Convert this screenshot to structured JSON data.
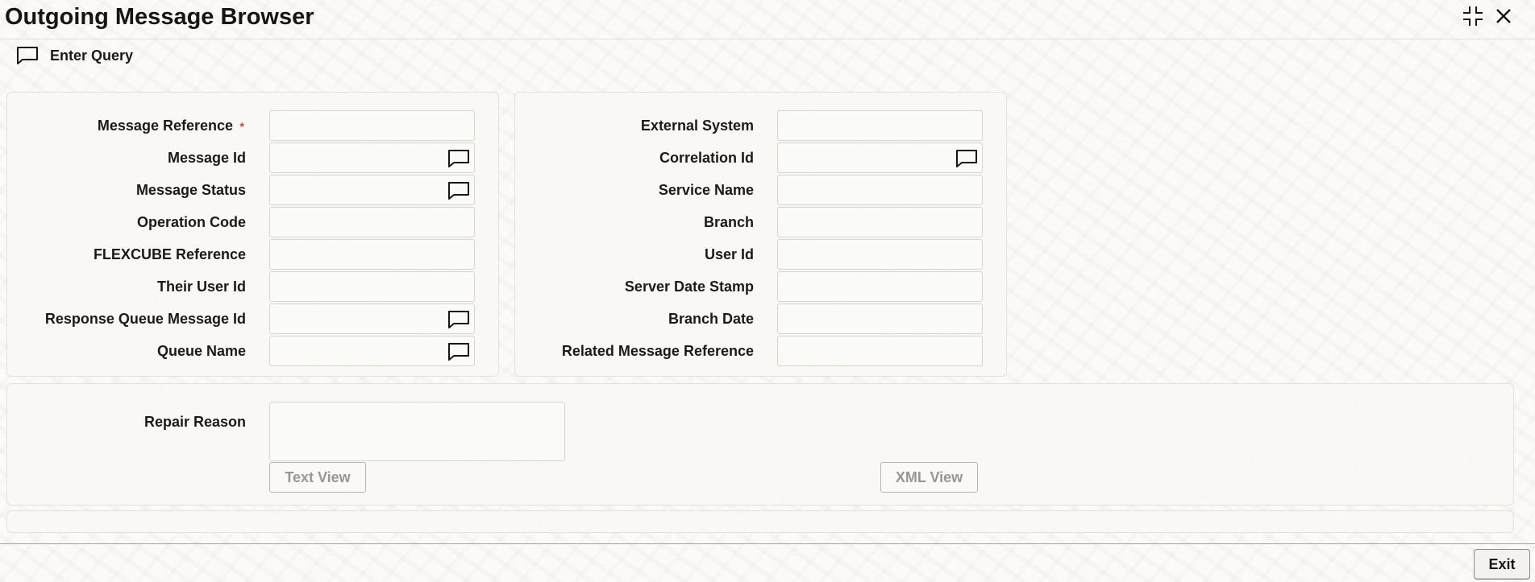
{
  "window": {
    "title": "Outgoing Message Browser"
  },
  "toolbar": {
    "enter_query_label": "Enter Query"
  },
  "left_fields": [
    {
      "label": "Message Reference",
      "value": "",
      "required": true,
      "lov": false
    },
    {
      "label": "Message Id",
      "value": "",
      "required": false,
      "lov": true
    },
    {
      "label": "Message Status",
      "value": "",
      "required": false,
      "lov": true
    },
    {
      "label": "Operation Code",
      "value": "",
      "required": false,
      "lov": false
    },
    {
      "label": "FLEXCUBE Reference",
      "value": "",
      "required": false,
      "lov": false
    },
    {
      "label": "Their User Id",
      "value": "",
      "required": false,
      "lov": false
    },
    {
      "label": "Response Queue Message Id",
      "value": "",
      "required": false,
      "lov": true
    },
    {
      "label": "Queue Name",
      "value": "",
      "required": false,
      "lov": true
    }
  ],
  "right_fields": [
    {
      "label": "External System",
      "value": "",
      "lov": false
    },
    {
      "label": "Correlation Id",
      "value": "",
      "lov": true
    },
    {
      "label": "Service Name",
      "value": "",
      "lov": false
    },
    {
      "label": "Branch",
      "value": "",
      "lov": false
    },
    {
      "label": "User Id",
      "value": "",
      "lov": false
    },
    {
      "label": "Server Date Stamp",
      "value": "",
      "lov": false
    },
    {
      "label": "Branch Date",
      "value": "",
      "lov": false
    },
    {
      "label": "Related Message Reference",
      "value": "",
      "lov": false
    }
  ],
  "repair": {
    "label": "Repair Reason",
    "value": "",
    "text_view_label": "Text View",
    "xml_view_label": "XML View"
  },
  "footer": {
    "exit_label": "Exit"
  },
  "icons": {
    "enter_query": "chat-bubble-icon",
    "lov": "chat-bubble-icon",
    "maximize": "collapse-corners-icon",
    "close": "close-icon"
  },
  "colors": {
    "required_asterisk": "#c74634",
    "disabled_button_text": "#9a9692"
  }
}
